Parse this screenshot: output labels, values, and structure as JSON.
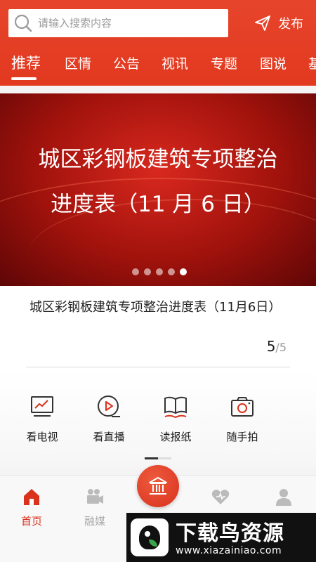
{
  "header": {
    "search_placeholder": "请输入搜索内容",
    "publish_label": "发布"
  },
  "tabs": [
    {
      "label": "推荐",
      "active": true
    },
    {
      "label": "区情"
    },
    {
      "label": "公告"
    },
    {
      "label": "视讯"
    },
    {
      "label": "专题"
    },
    {
      "label": "图说"
    },
    {
      "label": "基"
    }
  ],
  "banner": {
    "line1": "城区彩钢板建筑专项整治",
    "line2": "进度表（11 月 6 日）",
    "slide_count": 5,
    "active_slide": 5
  },
  "article": {
    "title": "城区彩钢板建筑专项整治进度表（11月6日）",
    "current": "5",
    "total": "/5"
  },
  "quick_actions": [
    {
      "label": "看电视",
      "icon": "tv-icon"
    },
    {
      "label": "看直播",
      "icon": "live-play-icon"
    },
    {
      "label": "读报纸",
      "icon": "newspaper-book-icon"
    },
    {
      "label": "随手拍",
      "icon": "camera-icon"
    }
  ],
  "bottom_nav": [
    {
      "label": "首页",
      "icon": "home-icon",
      "active": true
    },
    {
      "label": "融媒",
      "icon": "video-camera-icon"
    },
    {
      "label": "",
      "icon": "government-building-icon"
    },
    {
      "label": "",
      "icon": "heart-icon"
    },
    {
      "label": "",
      "icon": "user-icon"
    }
  ],
  "watermark": {
    "title": "下载鸟资源",
    "url": "www.xiazainiao.com"
  },
  "colors": {
    "brand_red": "#e2391f",
    "active_nav": "#d9321d"
  }
}
